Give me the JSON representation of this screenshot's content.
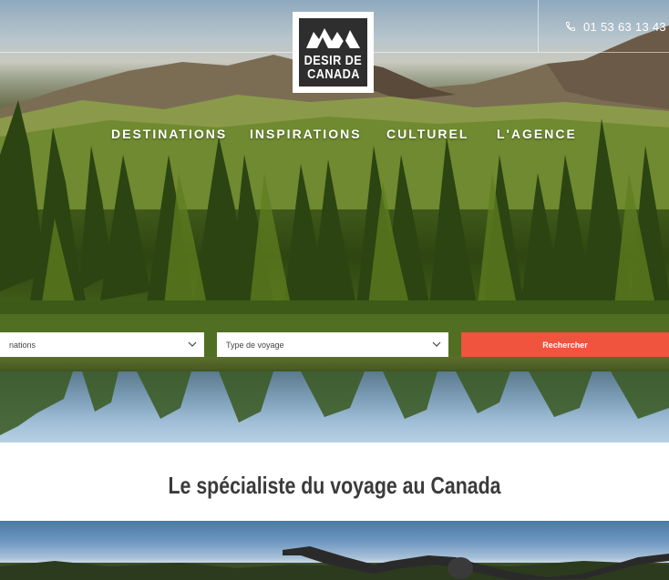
{
  "header": {
    "phone": "01 53 63 13 43",
    "logo": {
      "line1": "DESIR DE",
      "line2": "CANADA"
    }
  },
  "nav": {
    "items": [
      {
        "label": "DESTINATIONS"
      },
      {
        "label": "INSPIRATIONS"
      },
      {
        "label": "CULTUREL"
      },
      {
        "label": "L'AGENCE"
      }
    ]
  },
  "search": {
    "destination_value": "nations",
    "voyage_value": "Type de voyage",
    "button_label": "Rechercher"
  },
  "main": {
    "tagline": "Le spécialiste du voyage au Canada"
  },
  "colors": {
    "accent": "#f0533e",
    "logo_bg": "#2e2e2e",
    "text_dark": "#3b3b3b"
  },
  "icons": {
    "phone": "phone-icon",
    "chevron": "chevron-down-icon"
  }
}
